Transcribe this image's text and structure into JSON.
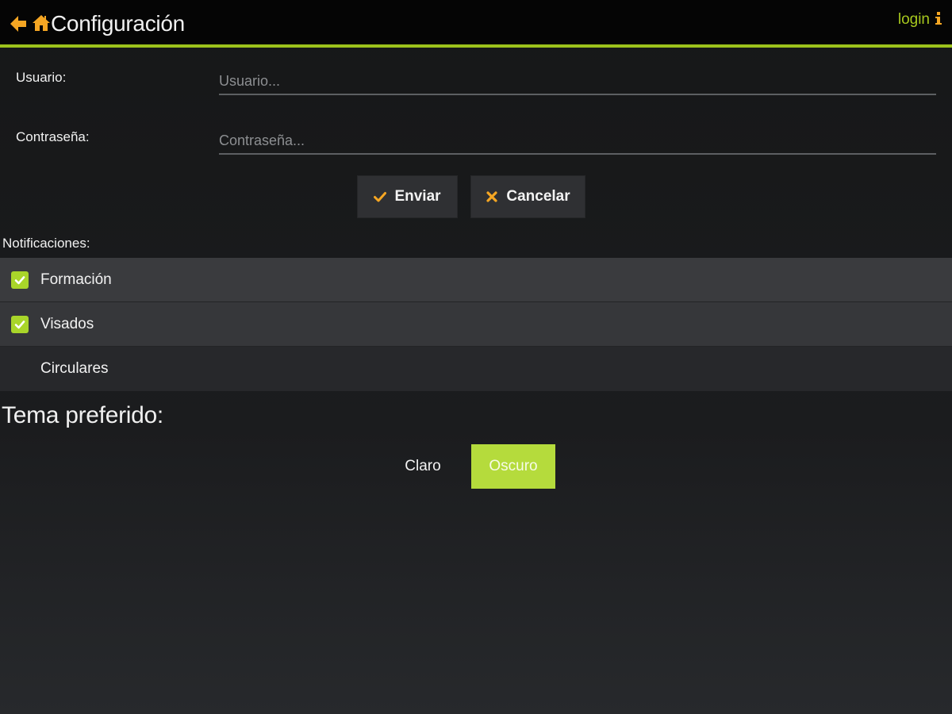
{
  "header": {
    "title": "Configuración",
    "login_label": "login",
    "icons": {
      "back": "arrow-left-icon",
      "home": "home-icon",
      "info": "info-icon"
    }
  },
  "form": {
    "usuario_label": "Usuario:",
    "usuario_placeholder": "Usuario...",
    "usuario_value": "",
    "password_label": "Contraseña:",
    "password_placeholder": "Contraseña...",
    "password_value": ""
  },
  "actions": {
    "enviar_label": "Enviar",
    "cancelar_label": "Cancelar"
  },
  "notifications": {
    "label": "Notificaciones:",
    "items": [
      {
        "label": "Formación",
        "checked": true
      },
      {
        "label": "Visados",
        "checked": true
      },
      {
        "label": "Circulares",
        "checked": false
      }
    ]
  },
  "theme": {
    "title": "Tema preferido:",
    "options": [
      {
        "label": "Claro",
        "selected": false
      },
      {
        "label": "Oscuro",
        "selected": true
      }
    ]
  },
  "colors": {
    "accent": "#9cc21c",
    "icon_orange": "#f5a623",
    "checkbox": "#a9d52a",
    "theme_selected": "#b5db3c",
    "row_a": "#3a3b3e",
    "row_b": "#36373a",
    "row_c": "#27282b"
  }
}
